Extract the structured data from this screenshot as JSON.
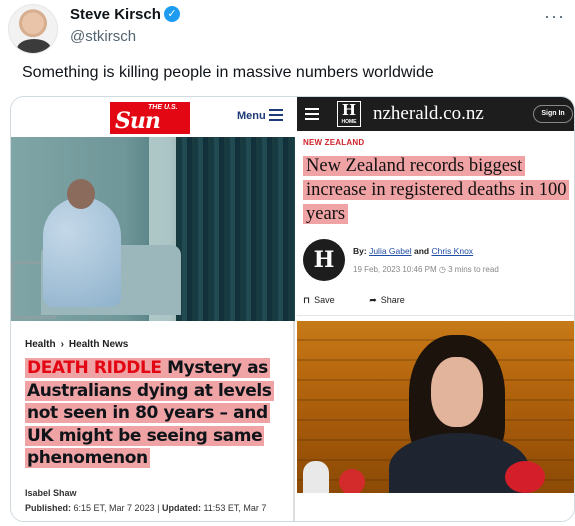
{
  "tweet": {
    "display_name": "Steve Kirsch",
    "verified_mark": "✓",
    "handle": "@stkirsch",
    "more": "···",
    "text": "Something is killing people in massive numbers worldwide"
  },
  "left_article": {
    "logo_small": "THE U.S.",
    "logo_big": "Sun",
    "menu_label": "Menu",
    "breadcrumb": [
      "Health",
      "Health News"
    ],
    "breadcrumb_sep": "›",
    "kicker": "DEATH RIDDLE",
    "headline": "Mystery as Australians dying at levels not seen in 80 years – and UK might be seeing same phenomenon",
    "author": "Isabel Shaw",
    "published_label": "Published:",
    "published": "6:15 ET, Mar 7 2023",
    "updated_label": "Updated:",
    "updated": "11:53 ET, Mar 7",
    "brand_color": "#e30613",
    "highlight_color": "#f0a3a5"
  },
  "right_article": {
    "logo_mark": "H",
    "logo_home": "HOME",
    "brand": "nzherald.co.nz",
    "signin": "Sign In",
    "section": "NEW ZEALAND",
    "headline": "New Zealand records biggest increase in registered deaths in 100 years",
    "byline_mark": "H",
    "by_label": "By:",
    "author1": "Julia Gabel",
    "and": "and",
    "author2": "Chris Knox",
    "date": "19 Feb, 2023 10:46 PM",
    "read_time": "3 mins to read",
    "save_label": "Save",
    "share_label": "Share",
    "section_color": "#d0242b"
  },
  "icons": {
    "verified": "verified-badge-icon",
    "menu": "hamburger-menu-icon",
    "save": "bookmark-icon",
    "share": "share-arrow-icon",
    "clock": "clock-icon"
  }
}
